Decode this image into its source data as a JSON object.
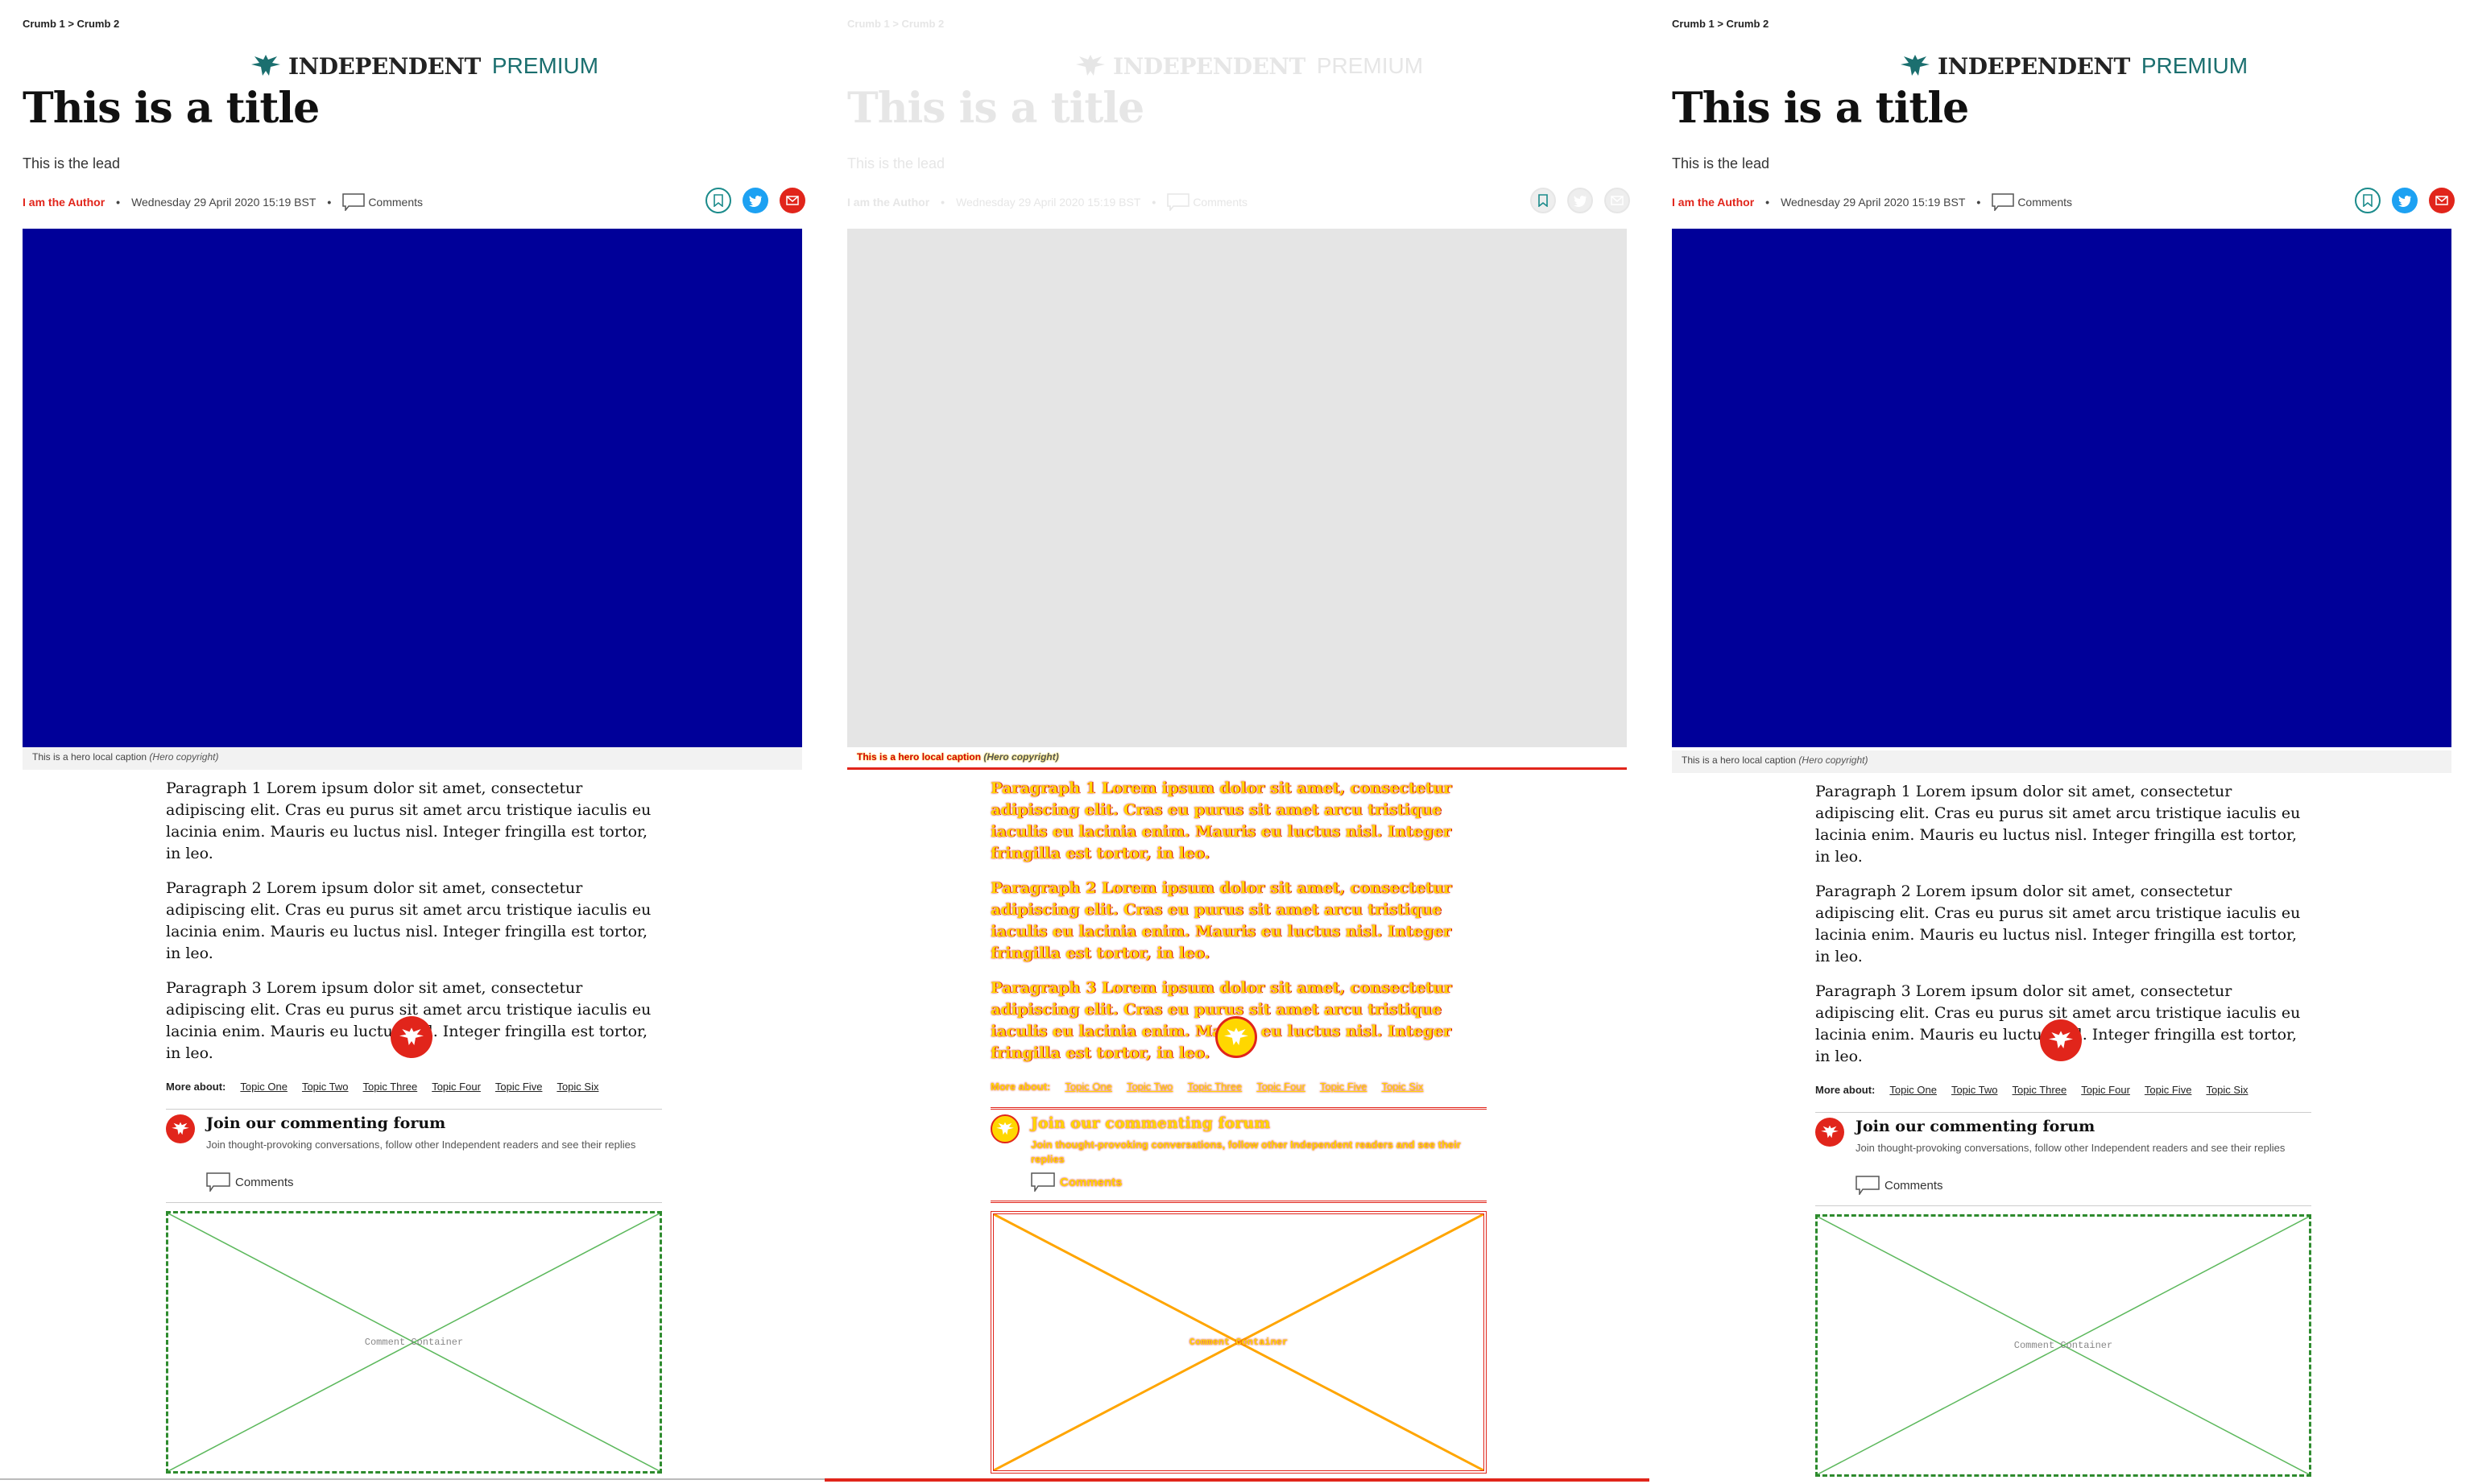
{
  "breadcrumb": "Crumb 1 > Crumb 2",
  "brand": {
    "name": "INDEPENDENT",
    "tier": "PREMIUM"
  },
  "title": "This is a title",
  "lead": "This is the lead",
  "byline": {
    "author": "I am the Author",
    "date": "Wednesday 29 April 2020 15:19 BST",
    "comments_label": "Comments"
  },
  "social_icons": [
    "bookmark-icon",
    "twitter-icon",
    "email-icon"
  ],
  "hero": {
    "caption": "This is a hero local caption",
    "copyright": "(Hero copyright)"
  },
  "paragraphs": [
    "Paragraph 1 Lorem ipsum dolor sit amet, consectetur adipiscing elit. Cras eu purus sit amet arcu tristique iaculis eu lacinia enim. Mauris eu luctus nisl. Integer fringilla est tortor, in leo.",
    "Paragraph 2 Lorem ipsum dolor sit amet, consectetur adipiscing elit. Cras eu purus sit amet arcu tristique iaculis eu lacinia enim. Mauris eu luctus nisl. Integer fringilla est tortor, in leo.",
    "Paragraph 3 Lorem ipsum dolor sit amet, consectetur adipiscing elit. Cras eu purus sit amet arcu tristique iaculis eu lacinia enim. Mauris eu luctus nisl. Integer fringilla est tortor, in leo."
  ],
  "more_about": {
    "label": "More about:",
    "topics": [
      "Topic One",
      "Topic Two",
      "Topic Three",
      "Topic Four",
      "Topic Five",
      "Topic Six"
    ]
  },
  "forum": {
    "title": "Join our commenting forum",
    "description": "Join thought-provoking conversations, follow other Independent readers and see their replies",
    "comments_label": "Comments"
  },
  "comment_container_label": "Comment Container",
  "colors": {
    "accent_red": "#e1251b",
    "brand_teal": "#1b6f6f",
    "hero_blue": "#000099",
    "twitter_blue": "#1da1f2",
    "placeholder_green": "#2e8b2e"
  }
}
